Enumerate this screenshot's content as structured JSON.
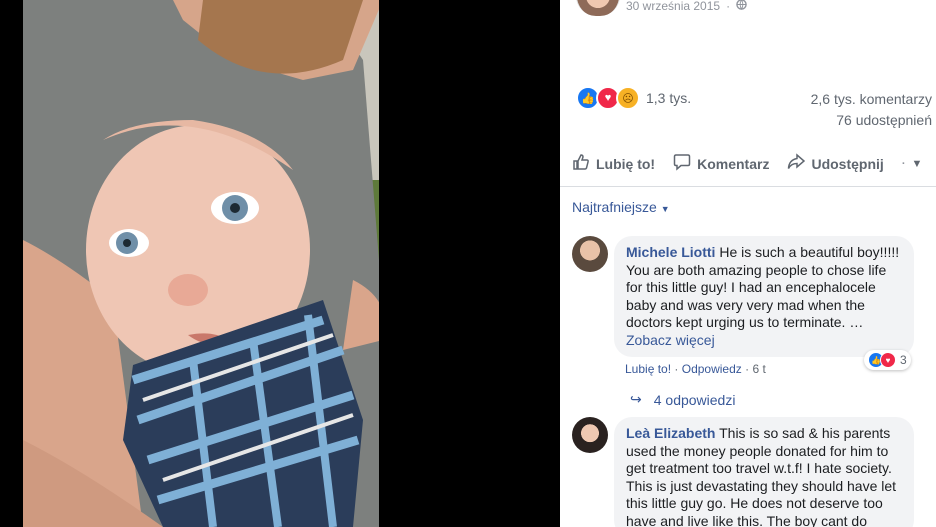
{
  "post": {
    "date": "30 września 2015",
    "privacy_icon": "globe-icon"
  },
  "reactions": {
    "icons": [
      "like-icon",
      "love-icon",
      "sad-icon"
    ],
    "count": "1,3 tys.",
    "comments": "2,6 tys. komentarzy",
    "shares": "76 udostępnień"
  },
  "actions": {
    "like": "Lubię to!",
    "comment": "Komentarz",
    "share": "Udostępnij"
  },
  "sort": {
    "label": "Najtrafniejsze"
  },
  "comments": [
    {
      "author": "Michele Liotti",
      "text": "He is such a beautiful boy!!!!! You are both amazing people to chose life for this little guy! I had an encephalocele baby and was very very mad when the doctors kept urging us to terminate. …",
      "see_more": "Zobacz więcej",
      "like_label": "Lubię to!",
      "reply_label": "Odpowiedz",
      "time": "6 t",
      "reaction_count": "3",
      "replies_label": "4 odpowiedzi"
    },
    {
      "author": "Leà Elizabeth",
      "text": "This is so sad & his parents used the money people donated for him to get treatment too travel w.t.f! I hate society. This is just devastating they should have let this little guy go. He does not deserve too have and live like this. The boy cant do"
    }
  ],
  "colors": {
    "link": "#385898",
    "like": "#1877f2",
    "love": "#f02849",
    "sad": "#f7b125",
    "bubble": "#f2f3f5"
  }
}
